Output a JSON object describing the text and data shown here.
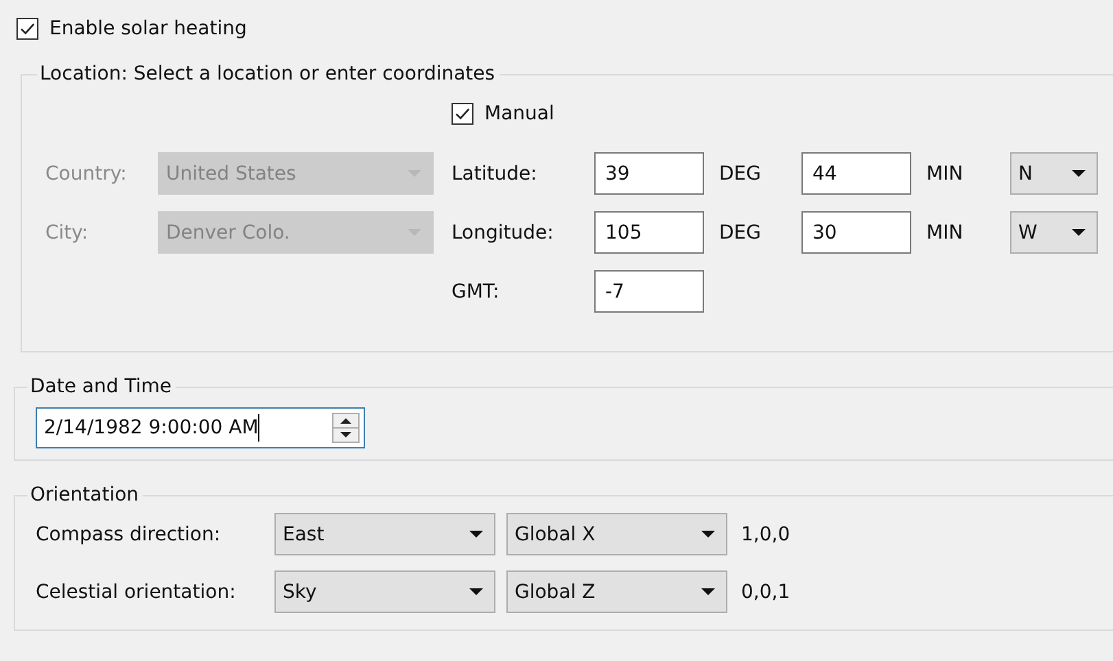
{
  "enable_solar_heating": {
    "label": "Enable solar heating",
    "checked": true
  },
  "location": {
    "legend": "Location: Select a location or enter coordinates",
    "manual": {
      "label": "Manual",
      "checked": true
    },
    "country": {
      "label": "Country:",
      "value": "United States",
      "disabled": true
    },
    "city": {
      "label": "City:",
      "value": "Denver Colo.",
      "disabled": true
    },
    "latitude": {
      "label": "Latitude:",
      "degrees": "39",
      "deg_unit": "DEG",
      "minutes": "44",
      "min_unit": "MIN",
      "hemisphere": "N"
    },
    "longitude": {
      "label": "Longitude:",
      "degrees": "105",
      "deg_unit": "DEG",
      "minutes": "30",
      "min_unit": "MIN",
      "hemisphere": "W"
    },
    "gmt": {
      "label": "GMT:",
      "value": "-7"
    }
  },
  "date_time": {
    "legend": "Date and Time",
    "value": "2/14/1982 9:00:00 AM",
    "focused": true
  },
  "orientation": {
    "legend": "Orientation",
    "rows": [
      {
        "label": "Compass direction:",
        "direction": "East",
        "axis": "Global X",
        "vector": "1,0,0"
      },
      {
        "label": "Celestial orientation:",
        "direction": "Sky",
        "axis": "Global Z",
        "vector": "0,0,1"
      }
    ]
  }
}
